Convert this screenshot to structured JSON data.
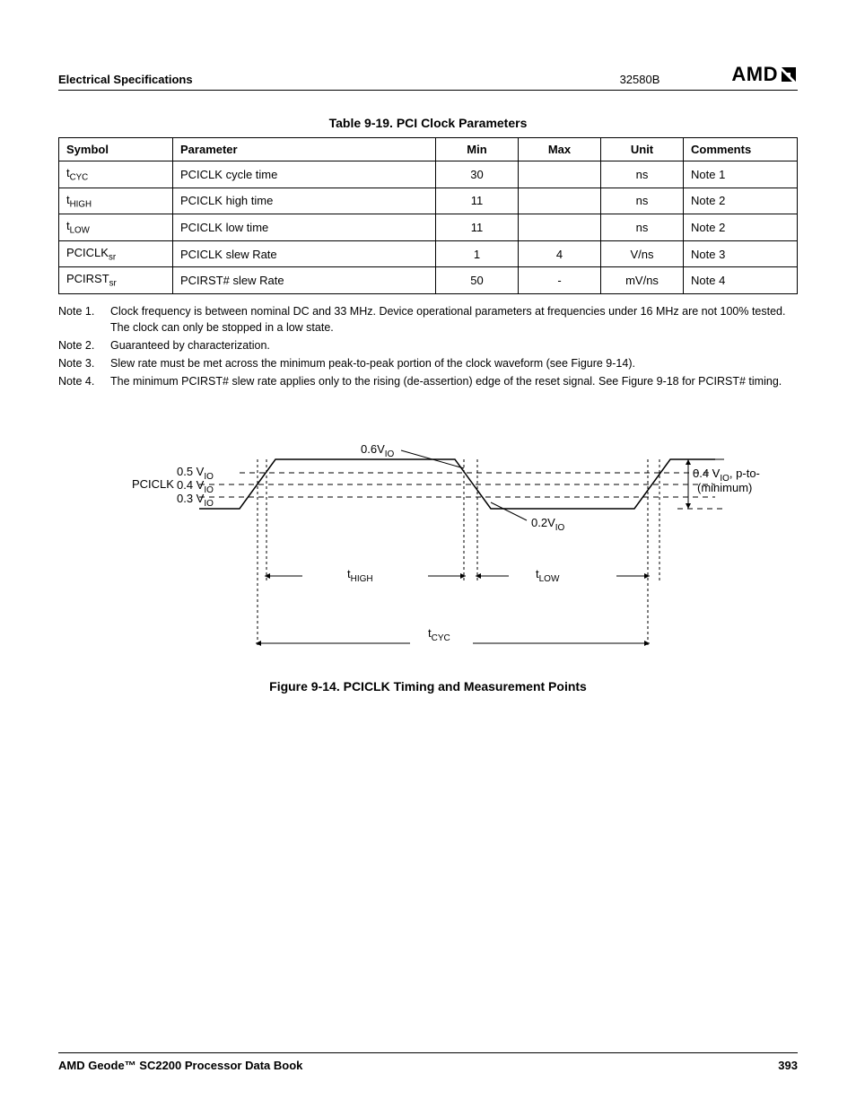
{
  "header": {
    "section": "Electrical Specifications",
    "docnum": "32580B",
    "logo": "AMD"
  },
  "table": {
    "caption": "Table 9-19.  PCI Clock Parameters",
    "headers": [
      "Symbol",
      "Parameter",
      "Min",
      "Max",
      "Unit",
      "Comments"
    ],
    "rows": [
      {
        "sym_base": "t",
        "sym_sub": "CYC",
        "param": "PCICLK cycle time",
        "min": "30",
        "max": "",
        "unit": "ns",
        "comments": "Note 1"
      },
      {
        "sym_base": "t",
        "sym_sub": "HIGH",
        "param": "PCICLK high time",
        "min": "11",
        "max": "",
        "unit": "ns",
        "comments": "Note 2"
      },
      {
        "sym_base": "t",
        "sym_sub": "LOW",
        "param": "PCICLK low time",
        "min": "11",
        "max": "",
        "unit": "ns",
        "comments": "Note 2"
      },
      {
        "sym_base": "PCICLK",
        "sym_sub": "sr",
        "param": "PCICLK slew Rate",
        "min": "1",
        "max": "4",
        "unit": "V/ns",
        "comments": "Note 3"
      },
      {
        "sym_base": "PCIRST",
        "sym_sub": "sr",
        "param": "PCIRST# slew Rate",
        "min": "50",
        "max": "-",
        "unit": "mV/ns",
        "comments": "Note 4"
      }
    ]
  },
  "notes": [
    {
      "label": "Note 1.",
      "text": "Clock frequency is between nominal DC and 33 MHz. Device operational parameters at frequencies under 16 MHz are not 100% tested. The clock can only be stopped in a low state."
    },
    {
      "label": "Note 2.",
      "text": "Guaranteed by characterization."
    },
    {
      "label": "Note 3.",
      "text": "Slew rate must be met across the minimum peak-to-peak portion of the clock waveform (see Figure 9-14)."
    },
    {
      "label": "Note 4.",
      "text": "The minimum PCIRST# slew rate applies only to the rising (de-assertion) edge of the reset signal. See Figure 9-18 for PCIRST# timing."
    }
  ],
  "figure": {
    "caption": "Figure 9-14.  PCICLK Timing and Measurement Points",
    "labels": {
      "pciclk": "PCICLK",
      "v05": "0.5 V",
      "v04": "0.4 V",
      "v03": "0.3 V",
      "v06top": "0.6V",
      "v02bot": "0.2V",
      "io": "IO",
      "thigh_base": "t",
      "thigh_sub": "HIGH",
      "tlow_base": "t",
      "tlow_sub": "LOW",
      "tcyc_base": "t",
      "tcyc_sub": "CYC",
      "ptop1": "0.4 V",
      "ptop2": ", p-to-p",
      "ptop3": "(minimum)"
    }
  },
  "footer": {
    "left": "AMD Geode™ SC2200  Processor Data Book",
    "right": "393"
  }
}
